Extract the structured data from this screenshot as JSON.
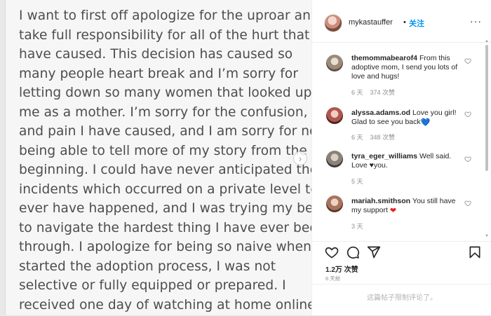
{
  "post": {
    "lines": [
      "I want to first off apologize for the uproar and",
      "take full responsibility for all of the hurt that I",
      "have caused. This decision has caused so",
      "many people heart break and I’m sorry for",
      "letting down so many women that looked up to",
      "me as a mother. I’m sorry for the confusion,",
      "and pain I have caused, and I am sorry for not",
      "being able to tell more of my story from the",
      "beginning. I could have never anticipated the",
      "incidents which occurred on a private level to",
      "ever have happened, and I was trying my best",
      "to navigate the hardest thing I have ever been",
      "through. I apologize for being so naive when I",
      "started the adoption process, I was not",
      "selective or fully equipped or prepared. I",
      "received one day of watching at home online"
    ],
    "next_arrow": "›"
  },
  "header": {
    "username": "mykastauffer",
    "dot": "•",
    "follow_label": "关注",
    "more": "···"
  },
  "comments": [
    {
      "username": "themommabearof4",
      "text": "From this adoptive mom, I send you lots of love and hugs!",
      "time": "6 天",
      "likes": "374 次赞",
      "emoji": ""
    },
    {
      "username": "alyssa.adams.od",
      "text": "Love you girl! Glad to see you back",
      "time": "6 天",
      "likes": "348 次赞",
      "emoji": "💙"
    },
    {
      "username": "tyra_eger_williams",
      "text": "Well said. Love ♥you.",
      "time": "5 天",
      "likes": "",
      "emoji": ""
    },
    {
      "username": "mariah.smithson",
      "text": "You still have my support",
      "time": "3 天",
      "likes": "",
      "emoji": "❤"
    }
  ],
  "actions": {
    "likes_count": "1.2万 次赞",
    "time_posted": "6 天前"
  },
  "comments_disabled": "这篇帖子限制评论了。",
  "colors": {
    "follow_blue": "#0095f6",
    "text_primary": "#262626",
    "text_secondary": "#8e8e8e",
    "post_text": "#4d4d4d",
    "heart_red": "#ed1c24",
    "heart_blue": "#2aa7e6"
  },
  "icons": [
    "heart-icon",
    "comment-icon",
    "share-icon",
    "bookmark-icon",
    "chevron-right-icon",
    "more-icon"
  ]
}
